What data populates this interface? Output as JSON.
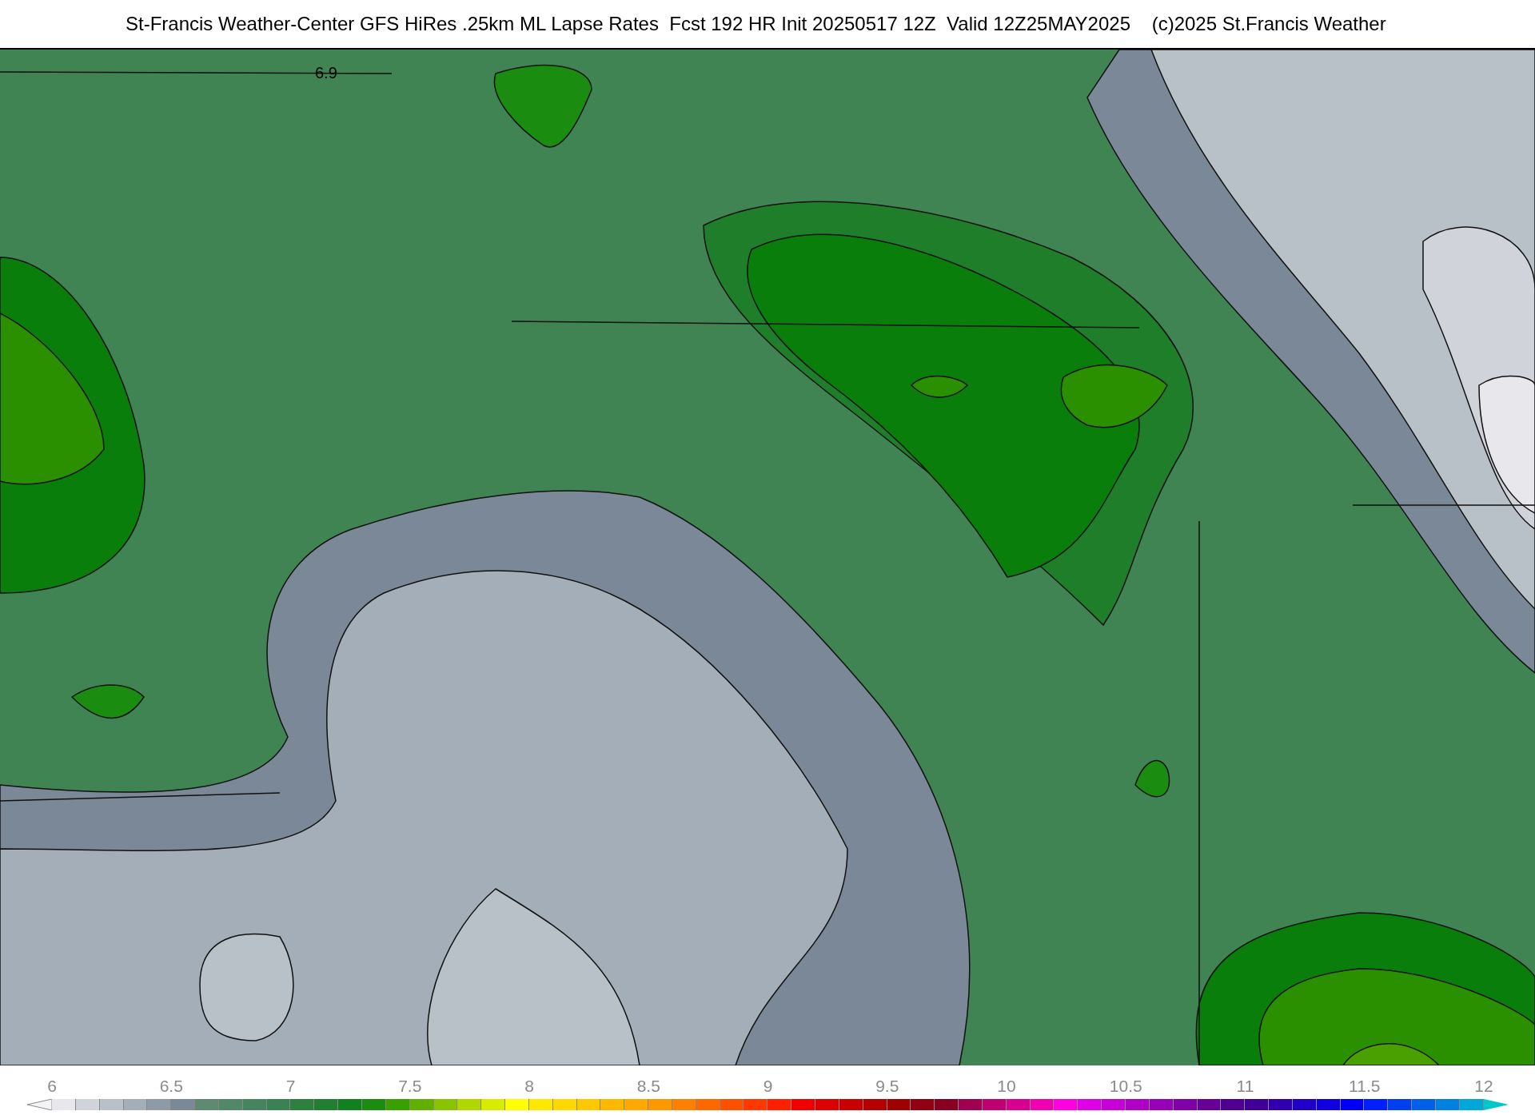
{
  "title": "St-Francis Weather-Center GFS HiRes .25km ML Lapse Rates  Fcst 192 HR Init 20250517 12Z  Valid 12Z25MAY2025    (c)2025 St.Francis Weather",
  "map": {
    "contour_labels": [
      "6.9"
    ]
  },
  "colorbar": {
    "ticks": [
      "6",
      "6.5",
      "7",
      "7.5",
      "8",
      "8.5",
      "9",
      "9.5",
      "10",
      "10.5",
      "11",
      "11.5",
      "12"
    ],
    "swatches": [
      {
        "kind": "under",
        "color": "#f4f4f6"
      },
      {
        "kind": "box",
        "color": "#e8e8ec"
      },
      {
        "kind": "box",
        "color": "#d0d4da"
      },
      {
        "kind": "box",
        "color": "#b8c0c8"
      },
      {
        "kind": "box",
        "color": "#a4aeb8"
      },
      {
        "kind": "box",
        "color": "#8e9aa8"
      },
      {
        "kind": "box",
        "color": "#7a8898"
      },
      {
        "kind": "box",
        "color": "#5e8a72"
      },
      {
        "kind": "box",
        "color": "#52886a"
      },
      {
        "kind": "box",
        "color": "#468460"
      },
      {
        "kind": "box",
        "color": "#3a8254"
      },
      {
        "kind": "box",
        "color": "#2e8040"
      },
      {
        "kind": "box",
        "color": "#227e30"
      },
      {
        "kind": "box",
        "color": "#128020"
      },
      {
        "kind": "box",
        "color": "#1a8c10"
      },
      {
        "kind": "box",
        "color": "#38a000"
      },
      {
        "kind": "box",
        "color": "#60b000"
      },
      {
        "kind": "box",
        "color": "#88c400"
      },
      {
        "kind": "box",
        "color": "#b0d800"
      },
      {
        "kind": "box",
        "color": "#d8ec00"
      },
      {
        "kind": "box",
        "color": "#ffff00"
      },
      {
        "kind": "box",
        "color": "#ffe800"
      },
      {
        "kind": "box",
        "color": "#ffd800"
      },
      {
        "kind": "box",
        "color": "#ffc800"
      },
      {
        "kind": "box",
        "color": "#ffb800"
      },
      {
        "kind": "box",
        "color": "#ffa800"
      },
      {
        "kind": "box",
        "color": "#ff9800"
      },
      {
        "kind": "box",
        "color": "#ff8000"
      },
      {
        "kind": "box",
        "color": "#ff6800"
      },
      {
        "kind": "box",
        "color": "#ff5000"
      },
      {
        "kind": "box",
        "color": "#ff3800"
      },
      {
        "kind": "box",
        "color": "#ff2000"
      },
      {
        "kind": "box",
        "color": "#f00000"
      },
      {
        "kind": "box",
        "color": "#dc0000"
      },
      {
        "kind": "box",
        "color": "#c80000"
      },
      {
        "kind": "box",
        "color": "#b40000"
      },
      {
        "kind": "box",
        "color": "#a00000"
      },
      {
        "kind": "box",
        "color": "#900010"
      },
      {
        "kind": "box",
        "color": "#880020"
      },
      {
        "kind": "box",
        "color": "#a00050"
      },
      {
        "kind": "box",
        "color": "#c00070"
      },
      {
        "kind": "box",
        "color": "#d80090"
      },
      {
        "kind": "box",
        "color": "#f000b0"
      },
      {
        "kind": "box",
        "color": "#ff00e0"
      },
      {
        "kind": "box",
        "color": "#e000e8"
      },
      {
        "kind": "box",
        "color": "#c800d8"
      },
      {
        "kind": "box",
        "color": "#b000c8"
      },
      {
        "kind": "box",
        "color": "#9800b8"
      },
      {
        "kind": "box",
        "color": "#8000a8"
      },
      {
        "kind": "box",
        "color": "#680098"
      },
      {
        "kind": "box",
        "color": "#500090"
      },
      {
        "kind": "box",
        "color": "#400098"
      },
      {
        "kind": "box",
        "color": "#3000b0"
      },
      {
        "kind": "box",
        "color": "#2000c8"
      },
      {
        "kind": "box",
        "color": "#1000e0"
      },
      {
        "kind": "box",
        "color": "#0000f8"
      },
      {
        "kind": "box",
        "color": "#0020ff"
      },
      {
        "kind": "box",
        "color": "#0040f0"
      },
      {
        "kind": "box",
        "color": "#0060e8"
      },
      {
        "kind": "box",
        "color": "#0080e0"
      },
      {
        "kind": "box",
        "color": "#00a8d8"
      },
      {
        "kind": "over",
        "color": "#00c8c8"
      }
    ]
  }
}
